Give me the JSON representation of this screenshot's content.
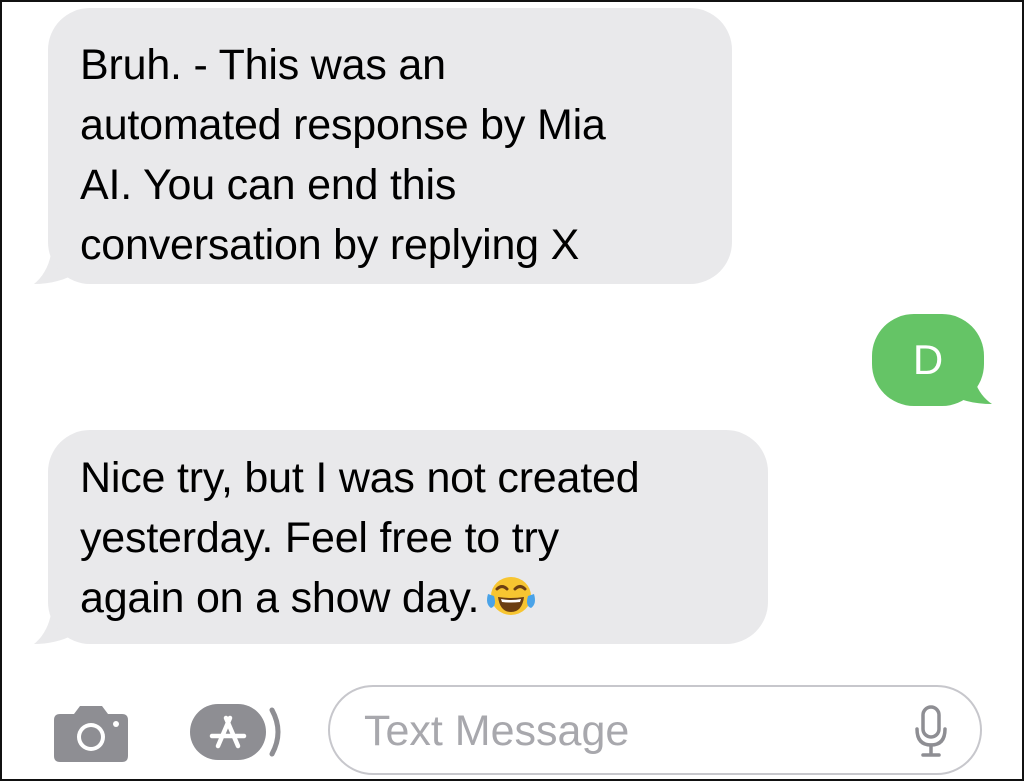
{
  "conversation": {
    "messages": [
      {
        "direction": "incoming",
        "text": "Bruh. - This was an\nautomated response by Mia\nAI. You can end this\nconversation by replying X"
      },
      {
        "direction": "outgoing",
        "text": "D"
      },
      {
        "direction": "incoming",
        "text": "Nice try, but I was not created\nyesterday. Feel free to try\nagain on a show day.",
        "emoji": "tears-of-joy-emoji"
      }
    ]
  },
  "composer": {
    "placeholder": "Text Message",
    "camera_icon": "camera-icon",
    "apps_icon": "app-store-icon",
    "mic_icon": "microphone-icon"
  },
  "colors": {
    "incoming_bubble": "#e9e9eb",
    "outgoing_bubble": "#65c466",
    "icon_gray": "#8e8e93",
    "placeholder_gray": "#a8a8ad"
  }
}
